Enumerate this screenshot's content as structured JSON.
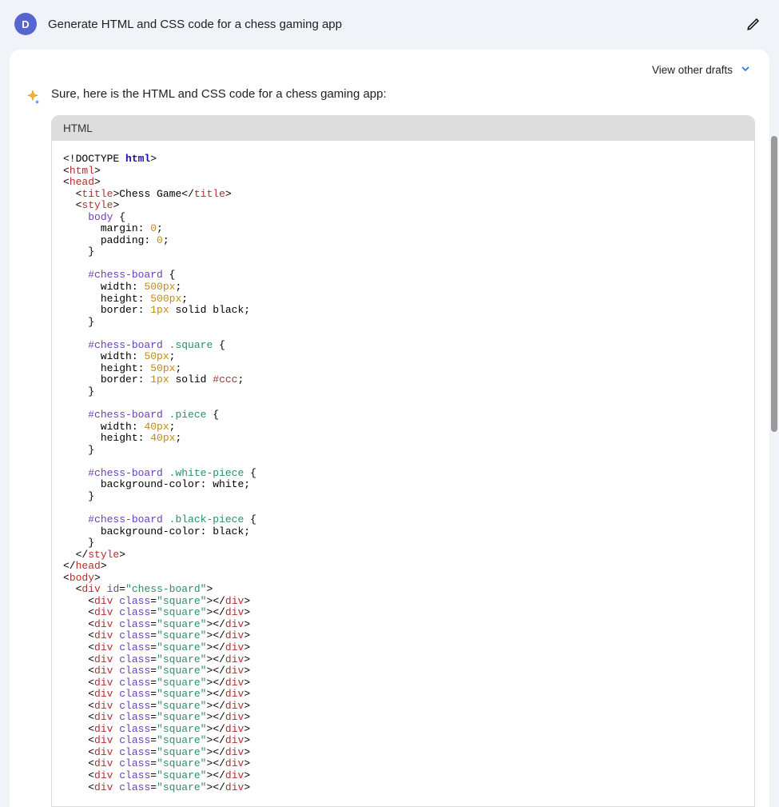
{
  "user": {
    "avatar_letter": "D",
    "prompt": "Generate HTML and CSS code for a chess gaming app"
  },
  "drafts": {
    "label": "View other drafts"
  },
  "reply": {
    "intro": "Sure, here is the HTML and CSS code for a chess gaming app:"
  },
  "code": {
    "language_label": "HTML",
    "tokens": {
      "doctype": "DOCTYPE",
      "html_kw": "html",
      "html_tag": "html",
      "head_tag": "head",
      "title_tag": "title",
      "title_text": "Chess Game",
      "style_tag": "style",
      "body_sel": "body",
      "margin_prop": "margin",
      "padding_prop": "padding",
      "zero": "0",
      "board_sel": "#chess-board",
      "square_sel": ".square",
      "piece_sel": ".piece",
      "white_piece_sel": ".white-piece",
      "black_piece_sel": ".black-piece",
      "width_prop": "width",
      "height_prop": "height",
      "border_prop": "border",
      "bg_prop": "background-color",
      "px500": "500px",
      "px1": "1px",
      "px50": "50px",
      "px40": "40px",
      "solid": "solid",
      "black_kw": "black",
      "white_kw": "white",
      "ccc": "#ccc",
      "body_tag": "body",
      "div_tag": "div",
      "id_attr": "id",
      "class_attr": "class",
      "chess_board_val": "chess-board",
      "square_val": "square"
    },
    "square_div_repeat": 17
  }
}
